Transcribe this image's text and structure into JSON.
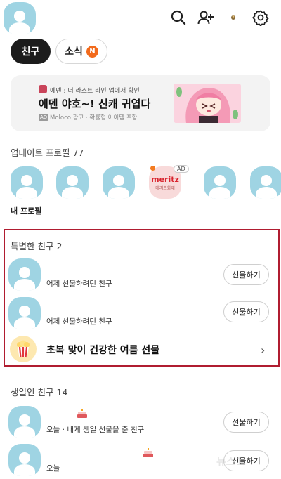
{
  "header": {
    "icons": [
      "search-icon",
      "add-friend-icon",
      "notification-dot-icon",
      "settings-icon"
    ]
  },
  "tabs": [
    {
      "label": "친구",
      "active": true
    },
    {
      "label": "소식",
      "badge": "N",
      "active": false
    }
  ],
  "ad_banner": {
    "source": "에덴 : 더 라스트 라인 앱에서 확인",
    "title": "에덴 야호~! 신캐 귀엽다",
    "ad_chip": "AD",
    "sub": "Moloco 광고 · 확률형 아이템 포함"
  },
  "updated_profiles": {
    "title": "업데이트 프로필 77",
    "my_profile_label": "내 프로필",
    "ad_item": {
      "logo": "meritz",
      "sub": "메리츠화재",
      "badge": "AD"
    }
  },
  "special_friends": {
    "title": "특별한 친구 2",
    "items": [
      {
        "status": "어제 선물하려던 친구",
        "button": "선물하기"
      },
      {
        "status": "어제 선물하려던 친구",
        "button": "선물하기"
      }
    ],
    "promo": {
      "text": "초복 맞이 건강한 여름 선물",
      "chevron": "›"
    }
  },
  "birthday_friends": {
    "title": "생일인 친구 14",
    "items": [
      {
        "status": "오늘 · 내게 생일 선물을 준 친구",
        "button": "선물하기"
      },
      {
        "status": "오늘",
        "button": "선물하기"
      }
    ]
  },
  "colors": {
    "avatar": "#9fd4e3",
    "accent_red": "#b01c30",
    "news_badge": "#f26a1b"
  },
  "watermark": "뉴스1"
}
